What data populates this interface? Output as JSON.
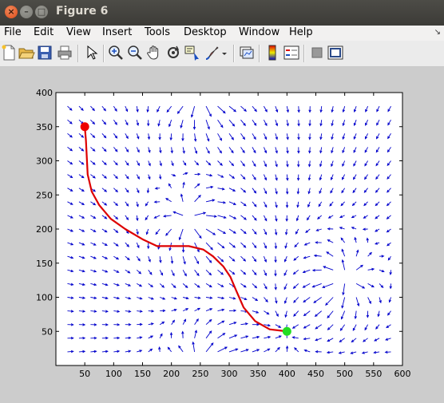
{
  "window": {
    "title": "Figure 6",
    "close_glyph": "×",
    "minimize_glyph": "–",
    "maximize_glyph": "□"
  },
  "menubar": {
    "items": [
      "File",
      "Edit",
      "View",
      "Insert",
      "Tools",
      "Desktop",
      "Window",
      "Help"
    ],
    "dock_glyph": "↘"
  },
  "toolbar": {
    "tools": [
      "new-figure-icon",
      "open-file-icon",
      "save-icon",
      "print-icon",
      "edit-plot-arrow-icon",
      "zoom-in-icon",
      "zoom-out-icon",
      "pan-hand-icon",
      "rotate-3d-icon",
      "data-cursor-icon",
      "brush-icon",
      "brush-dropdown-icon",
      "link-plot-icon",
      "insert-colorbar-icon",
      "insert-legend-icon",
      "hide-plot-tools-icon",
      "show-plot-tools-icon"
    ]
  },
  "colors": {
    "quiver": "#0000cc",
    "path": "#dd0000",
    "start_marker": "#ee0000",
    "goal_marker": "#22dd22",
    "axes_bg": "#ffffff",
    "figure_bg": "#cccccc"
  },
  "chart_data": {
    "type": "quiver",
    "xlim": [
      0,
      600
    ],
    "ylim": [
      0,
      400
    ],
    "xticks": [
      50,
      100,
      150,
      200,
      250,
      300,
      350,
      400,
      450,
      500,
      550,
      600
    ],
    "yticks": [
      50,
      100,
      150,
      200,
      250,
      300,
      350,
      400
    ],
    "grid": false,
    "quiver_field": {
      "x_range": [
        20,
        580
      ],
      "y_range": [
        20,
        380
      ],
      "spacing": 20,
      "goal": [
        400,
        50
      ],
      "obstacles": [
        {
          "center": [
            230,
            215
          ],
          "repulsion": 1
        },
        {
          "center": [
            500,
            125
          ],
          "repulsion": 1
        },
        {
          "center": [
            250,
            400
          ],
          "repulsion": 1
        },
        {
          "center": [
            250,
            0
          ],
          "repulsion": 1
        }
      ]
    },
    "path": {
      "x": [
        50,
        52,
        55,
        62,
        75,
        95,
        120,
        150,
        175,
        200,
        230,
        255,
        272,
        290,
        302,
        312,
        325,
        345,
        370,
        400
      ],
      "y": [
        350,
        330,
        280,
        255,
        235,
        215,
        200,
        185,
        175,
        175,
        175,
        170,
        160,
        145,
        130,
        110,
        85,
        65,
        53,
        50
      ]
    },
    "start": {
      "x": 50,
      "y": 350
    },
    "goal_point": {
      "x": 400,
      "y": 50
    }
  }
}
